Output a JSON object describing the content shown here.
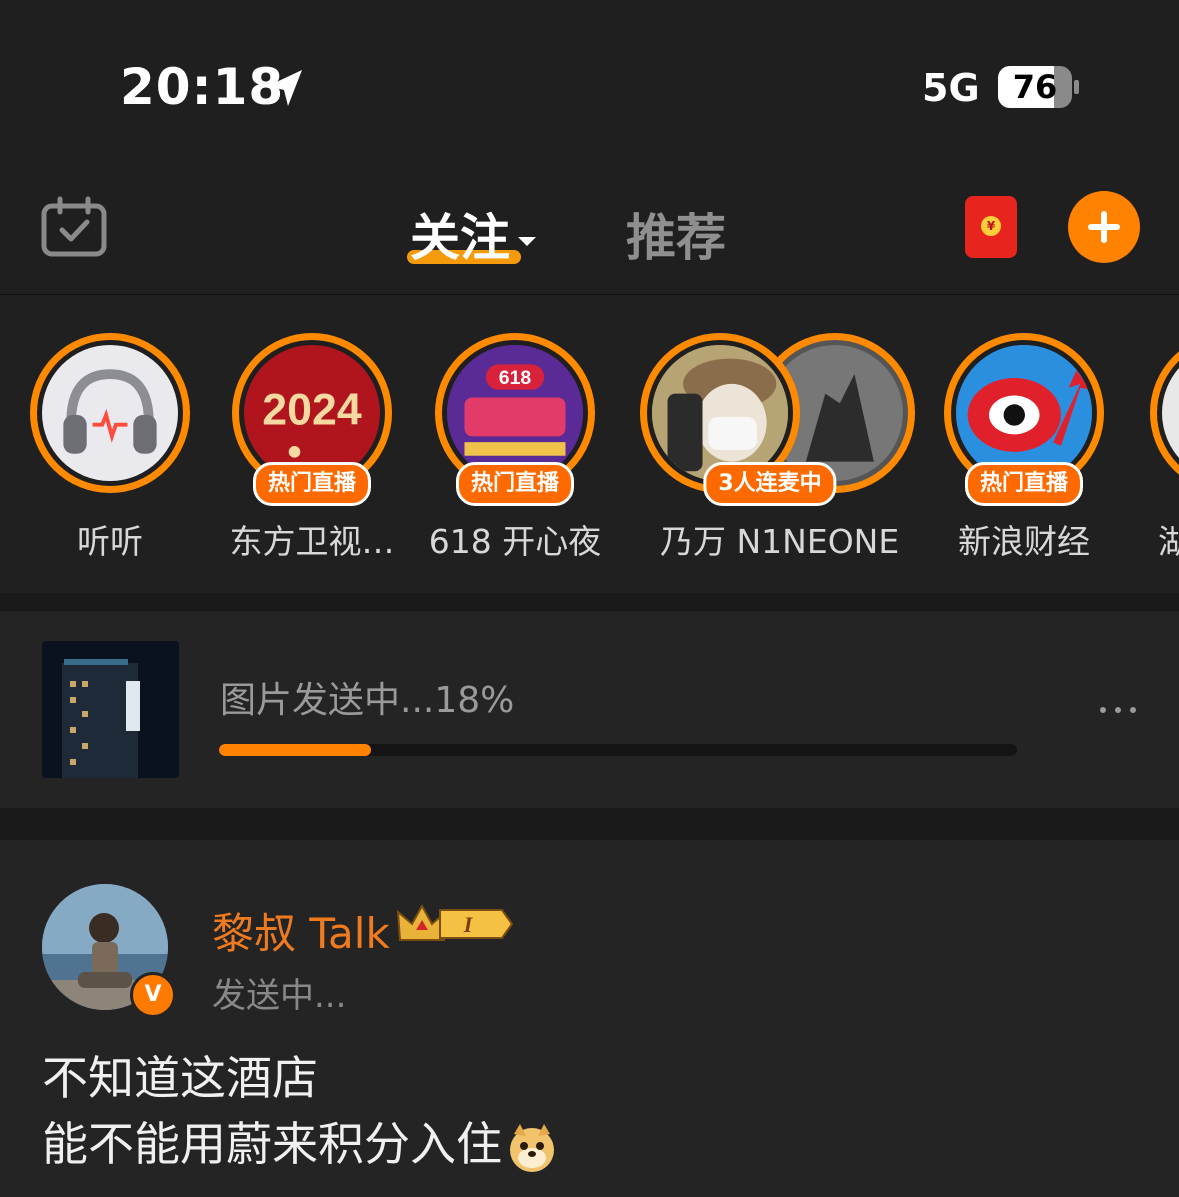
{
  "status_bar": {
    "time": "20:18",
    "network": "5G",
    "battery": "76",
    "battery_level": 0.76
  },
  "nav": {
    "tabs": [
      {
        "label": "关注",
        "active": true
      },
      {
        "label": "推荐",
        "active": false
      }
    ],
    "accent_color": "#ff8200"
  },
  "live_row": {
    "items": [
      {
        "name": "听听",
        "badge": ""
      },
      {
        "name": "东方卫视…",
        "badge": "热门直播"
      },
      {
        "name": "618 开心夜",
        "badge": "热门直播"
      },
      {
        "name": "乃万 N1NEONE",
        "badge": "3人连麦中"
      },
      {
        "name": "新浪财经",
        "badge": "热门直播"
      },
      {
        "name": "湖",
        "badge": ""
      }
    ]
  },
  "upload": {
    "status_text": "图片发送中...18%",
    "progress": 0.19
  },
  "post": {
    "author": "黎叔 Talk",
    "level_badge": "I",
    "status": "发送中...",
    "verified_mark": "V",
    "lines": [
      "不知道这酒店",
      "能不能用蔚来积分入住"
    ]
  }
}
